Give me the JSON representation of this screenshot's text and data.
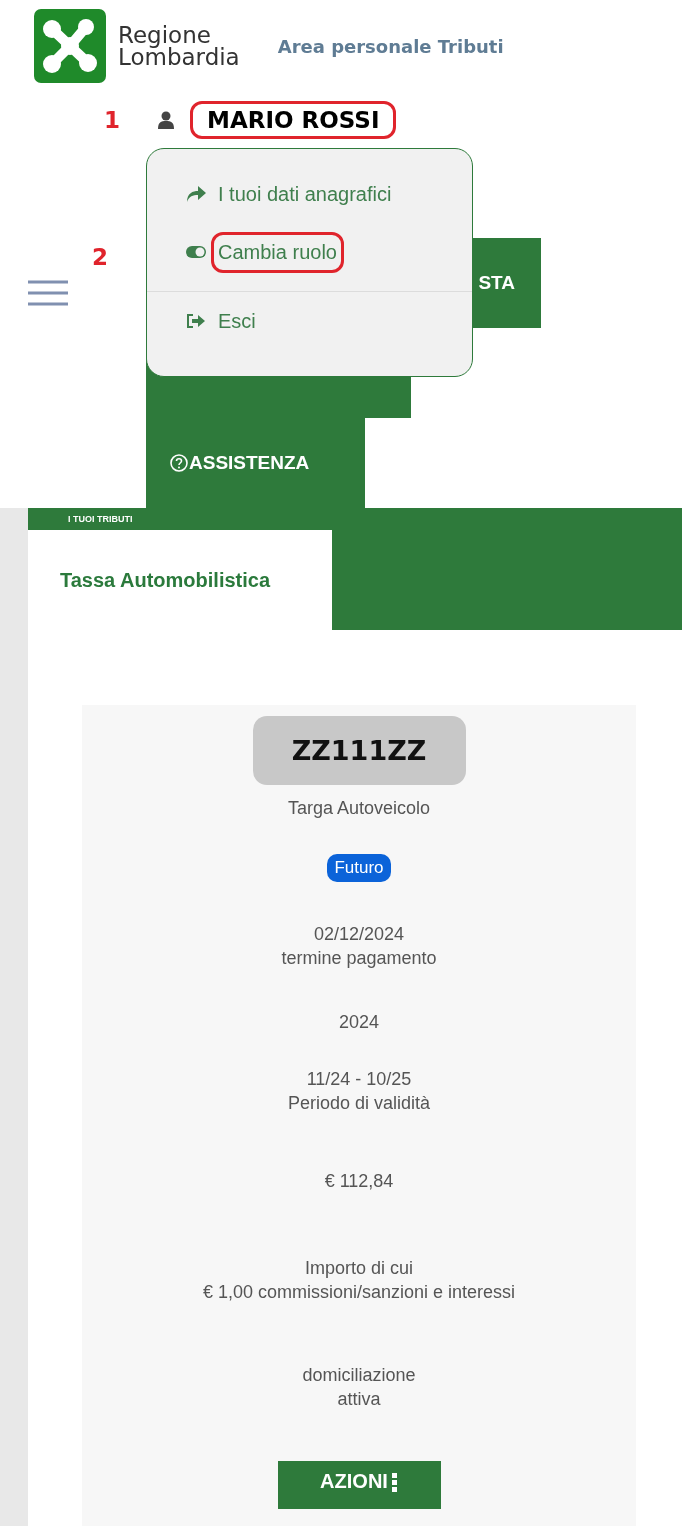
{
  "header": {
    "logo_lines": [
      "Regione",
      "Lombardia"
    ],
    "area_title": "Area personale Tributi"
  },
  "user": {
    "marker": "1",
    "name": "MARIO ROSSI",
    "highlighted": true
  },
  "user_menu": {
    "marker": "2",
    "items": [
      {
        "kind": "link",
        "label": "I tuoi dati anagrafici",
        "highlighted": false
      },
      {
        "kind": "toggle",
        "label": "Cambia ruolo",
        "highlighted": true
      },
      {
        "kind": "logout",
        "label": "Esci",
        "highlighted": false
      }
    ]
  },
  "nav": {
    "items": [
      {
        "kind": "text",
        "label": "STA"
      },
      {
        "kind": "covered"
      },
      {
        "kind": "help",
        "label": "ASSISTENZA"
      }
    ]
  },
  "section_bar": {
    "label": "I TUOI TRIBUTI"
  },
  "tabs": [
    {
      "label": "Tassa Automobilistica",
      "selected": true
    }
  ],
  "card": {
    "plate": "ZZ111ZZ",
    "plate_label": "Targa Autoveicolo",
    "status": "Futuro",
    "due_date": "02/12/2024",
    "due_label": "termine pagamento",
    "year": "2024",
    "validity": "11/24 - 10/25",
    "validity_label": "Periodo di validità",
    "amount": "€  112,84",
    "amount_label": "Importo di cui",
    "amount_detail": "€  1,00 commissioni/sanzioni e interessi",
    "direct_debit": [
      "domiciliazione",
      "attiva"
    ],
    "button": "AZIONI"
  }
}
